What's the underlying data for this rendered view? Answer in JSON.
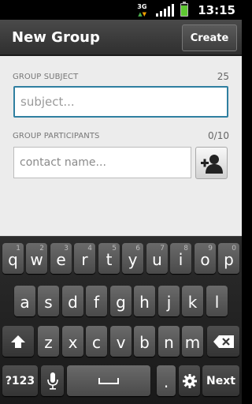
{
  "status_bar": {
    "network_label": "3G",
    "time": "13:15",
    "battery_level": 0.9,
    "icons": [
      "network-3g-icon",
      "signal-icon",
      "battery-icon"
    ]
  },
  "header": {
    "title": "New Group",
    "create_label": "Create"
  },
  "subject": {
    "label": "GROUP SUBJECT",
    "counter": "25",
    "placeholder": "subject..."
  },
  "participants": {
    "label": "GROUP PARTICIPANTS",
    "counter": "0/10",
    "placeholder": "contact name...",
    "add_icon": "add-contact-icon"
  },
  "keyboard": {
    "row1": [
      {
        "label": "q",
        "hint": "1"
      },
      {
        "label": "w",
        "hint": "2"
      },
      {
        "label": "e",
        "hint": "3"
      },
      {
        "label": "r",
        "hint": "4"
      },
      {
        "label": "t",
        "hint": "5"
      },
      {
        "label": "y",
        "hint": "6"
      },
      {
        "label": "u",
        "hint": "7"
      },
      {
        "label": "i",
        "hint": "8"
      },
      {
        "label": "o",
        "hint": "9"
      },
      {
        "label": "p",
        "hint": "0"
      }
    ],
    "row2": [
      "a",
      "s",
      "d",
      "f",
      "g",
      "h",
      "j",
      "k",
      "l"
    ],
    "row3": [
      "z",
      "x",
      "c",
      "v",
      "b",
      "n",
      "m"
    ],
    "symbols_label": "?123",
    "period_label": ".",
    "next_label": "Next",
    "icons": [
      "shift-icon",
      "backspace-icon",
      "microphone-icon",
      "space-icon",
      "settings-icon"
    ]
  },
  "colors": {
    "accent": "#2f7fa0",
    "background": "#ececec",
    "battery": "#5ec732"
  }
}
